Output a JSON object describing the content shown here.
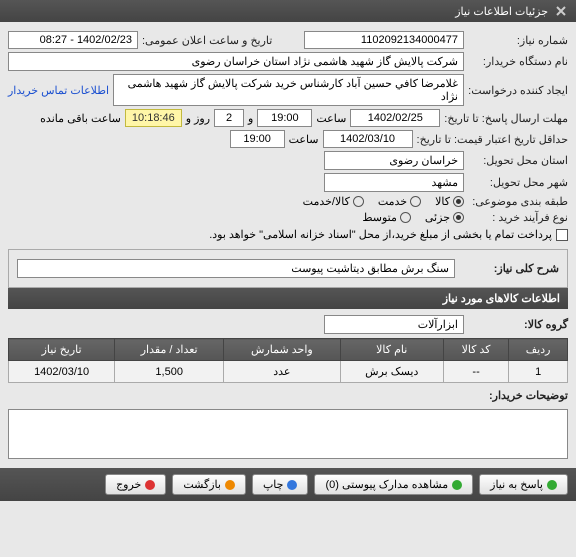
{
  "header": {
    "title": "جزئیات اطلاعات نیاز"
  },
  "f": {
    "req_no_lbl": "شماره نیاز:",
    "req_no": "1102092134000477",
    "pub_dt_lbl": "تاریخ و ساعت اعلان عمومی:",
    "pub_dt": "1402/02/23 - 08:27",
    "buyer_lbl": "نام دستگاه خریدار:",
    "buyer": "شرکت پالایش گاز شهید هاشمی نژاد   استان خراسان رضوی",
    "requester_lbl": "ایجاد کننده درخواست:",
    "requester": "غلامرضا کافي حسين آباد کارشناس خريد  شرکت پالایش گاز شهید هاشمی نژاد",
    "contact_link": "اطلاعات تماس خریدار",
    "deadline_lbl": "مهلت ارسال پاسخ: تا تاریخ:",
    "deadline_date": "1402/02/25",
    "hour_lbl": "ساعت",
    "deadline_time": "19:00",
    "and_lbl": "و",
    "days": "2",
    "days_lbl": "روز و",
    "countdown": "10:18:46",
    "remain_lbl": "ساعت باقی مانده",
    "credit_lbl": "حداقل تاریخ اعتبار قیمت: تا تاریخ:",
    "credit_date": "1402/03/10",
    "credit_time": "19:00",
    "province_lbl": "استان محل تحویل:",
    "province": "خراسان رضوی",
    "city_lbl": "شهر محل تحویل:",
    "city": "مشهد",
    "subject_lbl": "طبقه بندی موضوعی:",
    "opt_goods": "کالا",
    "opt_service": "خدمت",
    "opt_both": "کالا/خدمت",
    "proc_lbl": "نوع فرآیند خرید :",
    "opt_partial": "جزئی",
    "opt_medium": "متوسط",
    "pay_note": "پرداخت تمام یا بخشی از مبلغ خرید،از محل \"اسناد خزانه اسلامی\" خواهد بود."
  },
  "desc": {
    "section": "شرح کلی نیاز:",
    "text": "سنگ برش مطابق دیتاشیت پیوست"
  },
  "items": {
    "header": "اطلاعات کالاهای مورد نیاز",
    "group_lbl": "گروه کالا:",
    "group": "ابزارآلات",
    "cols": {
      "idx": "ردیف",
      "code": "کد کالا",
      "name": "نام کالا",
      "unit": "واحد شمارش",
      "qty": "تعداد / مقدار",
      "date": "تاریخ نیاز"
    },
    "rows": [
      {
        "idx": "1",
        "code": "--",
        "name": "دیسک برش",
        "unit": "عدد",
        "qty": "1,500",
        "date": "1402/03/10"
      }
    ]
  },
  "notes_lbl": "توضیحات خریدار:",
  "footer": {
    "respond": "پاسخ به نیاز",
    "attach": "مشاهده مدارک پیوستی (0)",
    "print": "چاپ",
    "back": "بازگشت",
    "exit": "خروج"
  }
}
